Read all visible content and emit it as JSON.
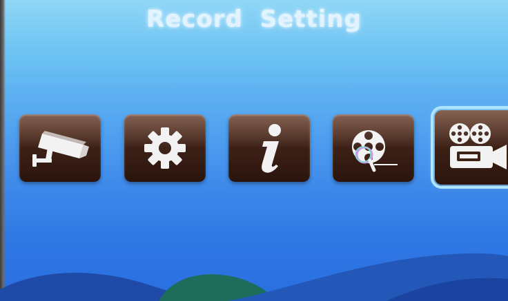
{
  "screen": {
    "title": "Record  Setting"
  },
  "menu": {
    "items": [
      {
        "id": "camera",
        "icon": "security-camera-icon",
        "selected": false
      },
      {
        "id": "settings",
        "icon": "gear-icon",
        "selected": false
      },
      {
        "id": "info",
        "icon": "info-icon",
        "selected": false
      },
      {
        "id": "playback",
        "icon": "film-reel-search-icon",
        "selected": false
      },
      {
        "id": "record-setting",
        "icon": "movie-camera-icon",
        "selected": true
      }
    ]
  },
  "colors": {
    "background_top": "#8fd6f6",
    "background_bottom": "#2a6ee0",
    "tile": "#3f2217",
    "selection_outline": "#aee6ff",
    "icon": "#f2f2f2"
  }
}
